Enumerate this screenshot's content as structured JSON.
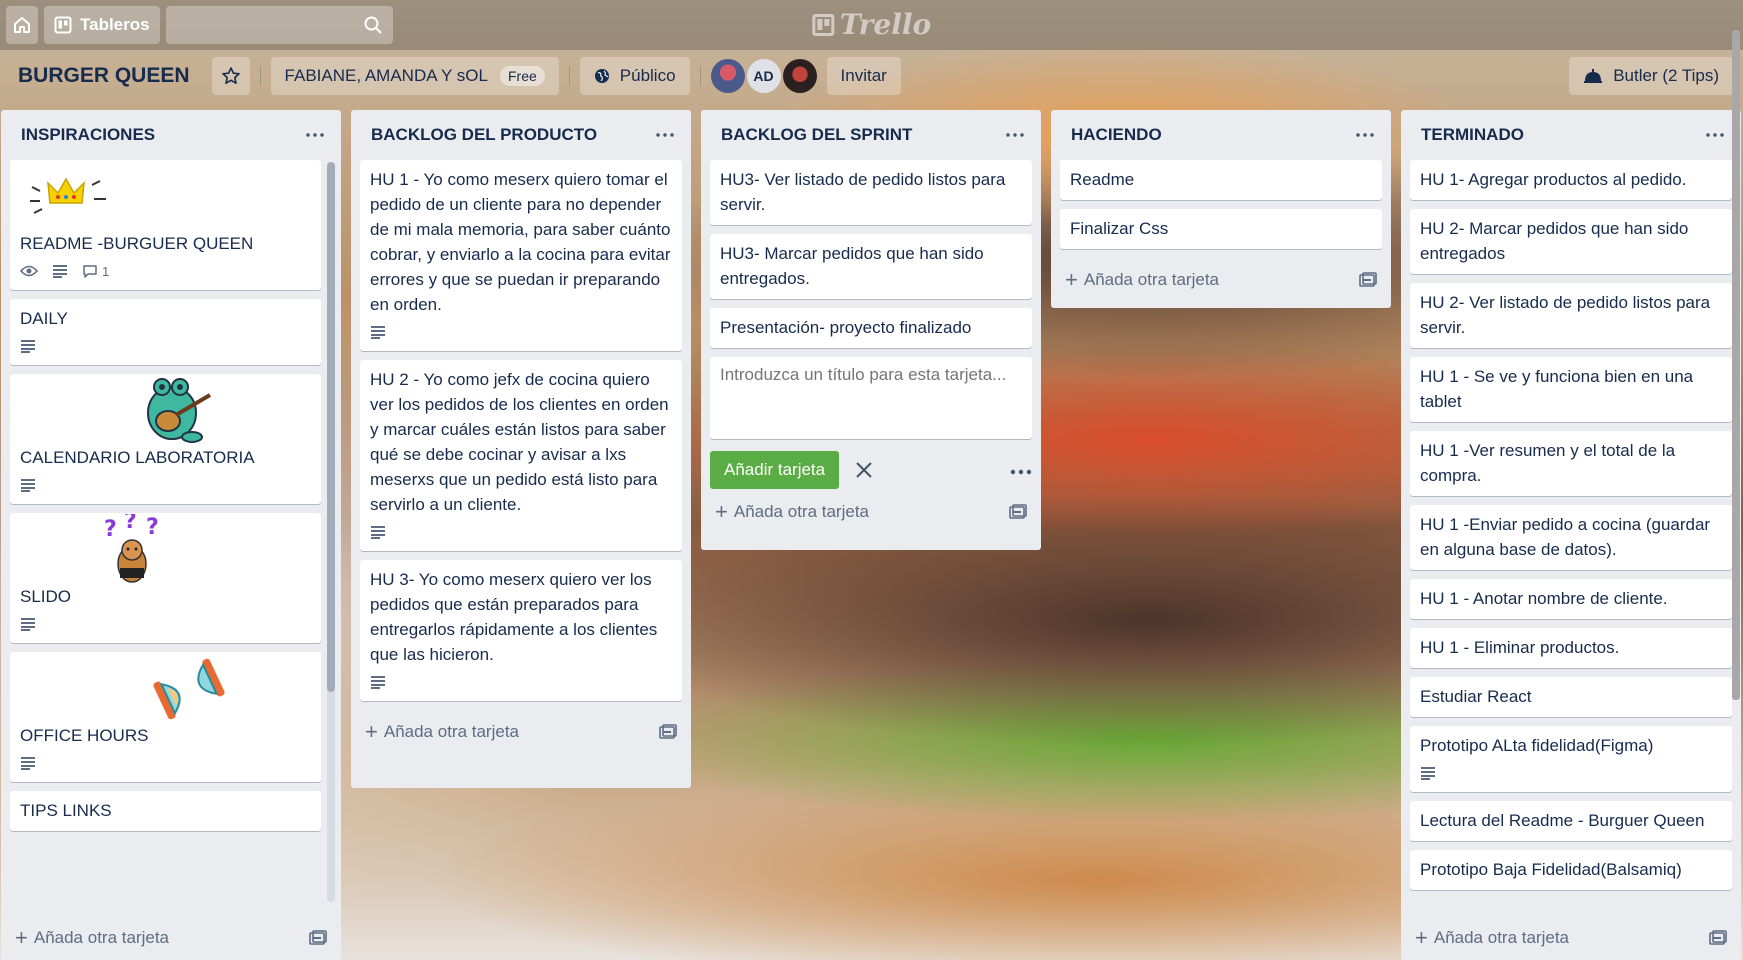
{
  "topbar": {
    "boards_label": "Tableros",
    "search_value": "",
    "logo_text": "Trello"
  },
  "header": {
    "board_title": "BURGER QUEEN",
    "team_name": "FABIANE, AMANDA Y sOL",
    "team_plan": "Free",
    "visibility": "Público",
    "member_initials": "AD",
    "invite_label": "Invitar",
    "butler_label": "Butler (2 Tips)"
  },
  "lists": [
    {
      "title": "INSPIRACIONES",
      "add_label": "Añada otra tarjeta",
      "cards": [
        {
          "title": "README -BURGUER QUEEN",
          "cover": "crown-sticker",
          "comments": "1"
        },
        {
          "title": "DAILY"
        },
        {
          "title": "CALENDARIO LABORATORIA",
          "cover": "frog-guitar-sticker"
        },
        {
          "title": "SLIDO",
          "cover": "dog-question-sticker"
        },
        {
          "title": "OFFICE HOURS",
          "cover": "hourglass-sticker"
        },
        {
          "title": "TIPS LINKS"
        }
      ]
    },
    {
      "title": "BACKLOG DEL PRODUCTO",
      "add_label": "Añada otra tarjeta",
      "cards": [
        {
          "title": "HU 1 - Yo como meserx quiero tomar el pedido de un cliente para no depender de mi mala memoria, para saber cuánto cobrar, y enviarlo a la cocina para evitar errores y que se puedan ir preparando en orden."
        },
        {
          "title": "HU 2 - Yo como jefx de cocina quiero ver los pedidos de los clientes en orden y marcar cuáles están listos para saber qué se debe cocinar y avisar a lxs meserxs que un pedido está listo para servirlo a un cliente."
        },
        {
          "title": "HU 3- Yo como meserx quiero ver los pedidos que están preparados para entregarlos rápidamente a los clientes que las hicieron."
        }
      ]
    },
    {
      "title": "BACKLOG DEL SPRINT",
      "add_label": "Añada otra tarjeta",
      "composer_placeholder": "Introduzca un título para esta tarjeta...",
      "composer_button": "Añadir tarjeta",
      "cards": [
        {
          "title": "HU3- Ver listado de pedido listos para servir."
        },
        {
          "title": "HU3- Marcar pedidos que han sido entregados."
        },
        {
          "title": "Presentación- proyecto finalizado"
        }
      ]
    },
    {
      "title": "HACIENDO",
      "add_label": "Añada otra tarjeta",
      "cards": [
        {
          "title": "Readme"
        },
        {
          "title": "Finalizar Css"
        }
      ]
    },
    {
      "title": "TERMINADO",
      "add_label": "Añada otra tarjeta",
      "cards": [
        {
          "title": "HU 1- Agregar productos al pedido."
        },
        {
          "title": "HU 2- Marcar pedidos que han sido entregados"
        },
        {
          "title": "HU 2- Ver listado de pedido listos para servir."
        },
        {
          "title": "HU 1 - Se ve y funciona bien en una tablet"
        },
        {
          "title": "HU 1 -Ver resumen y el total de la compra."
        },
        {
          "title": "HU 1 -Enviar pedido a cocina (guardar en alguna base de datos)."
        },
        {
          "title": "HU 1 - Anotar nombre de cliente."
        },
        {
          "title": "HU 1 - Eliminar productos."
        },
        {
          "title": "Estudiar React"
        },
        {
          "title": "Prototipo ALta fidelidad(Figma)"
        },
        {
          "title": "Lectura del Readme - Burguer Queen"
        },
        {
          "title": "Prototipo Baja Fidelidad(Balsamiq)"
        }
      ]
    }
  ],
  "colors": {
    "list_bg": "#ebecf0",
    "card_bg": "#ffffff",
    "text": "#172b4d",
    "muted": "#5e6c84",
    "button_green": "#5aac44"
  }
}
